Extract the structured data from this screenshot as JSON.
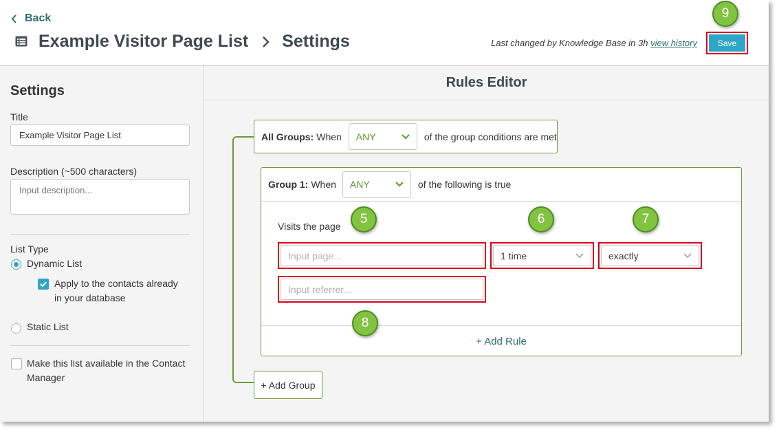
{
  "header": {
    "back_label": "Back",
    "list_name": "Example Visitor Page List",
    "section": "Settings",
    "last_changed_prefix": "Last changed by Knowledge Base in 3h ",
    "view_history_label": "view history",
    "save_label": "Save"
  },
  "sidebar": {
    "heading": "Settings",
    "title_label": "Title",
    "title_value": "Example Visitor Page List",
    "description_label": "Description (~500 characters)",
    "description_placeholder": "Input description...",
    "list_type_label": "List Type",
    "dynamic_list_label": "Dynamic List",
    "apply_label_line1": "Apply to the contacts already",
    "apply_label_line2": "in your database",
    "static_list_label": "Static List",
    "available_label_line1": "Make this list available in the Contact",
    "available_label_line2": "Manager"
  },
  "editor": {
    "title": "Rules Editor",
    "all_groups_prefix": "All Groups:",
    "all_groups_when": "When",
    "all_groups_select": "ANY",
    "all_groups_suffix": "of the group conditions are met",
    "group1_prefix": "Group 1:",
    "group1_when": "When",
    "group1_select": "ANY",
    "group1_suffix": "of the following is true",
    "rule_label": "Visits the page",
    "page_placeholder": "Input page...",
    "times_value": "1 time",
    "match_value": "exactly",
    "referrer_placeholder": "Input referrer...",
    "add_rule_label": "+ Add Rule",
    "add_group_label": "+ Add Group"
  },
  "callouts": {
    "rule": "5",
    "times": "6",
    "match": "7",
    "referrer": "8",
    "save": "9"
  },
  "colors": {
    "accent": "#2fa6c7",
    "group_border": "#6a9a3b",
    "highlight": "#d8001c",
    "callout": "#82c341",
    "link": "#2e6e6e"
  }
}
